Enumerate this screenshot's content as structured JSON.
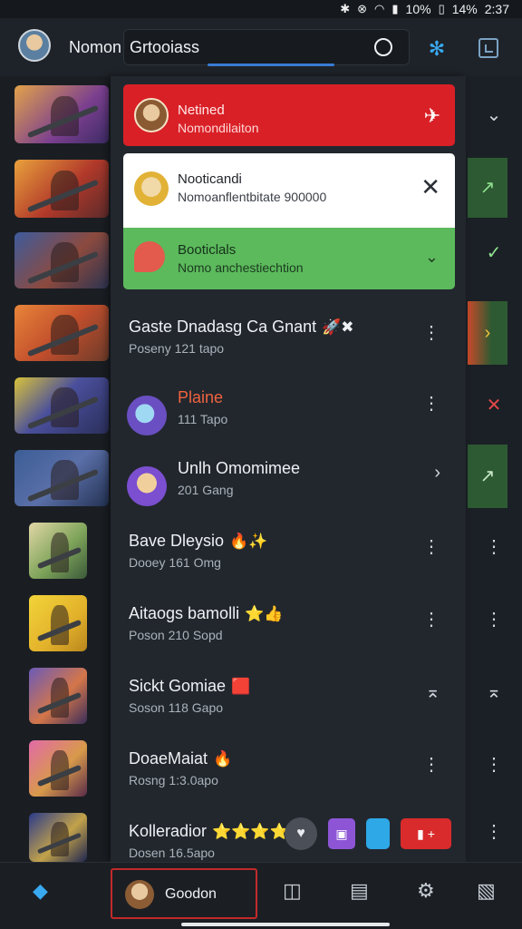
{
  "status_bar": {
    "icons": [
      "bluetooth-icon",
      "mute-icon",
      "wifi-icon",
      "signal-icon"
    ],
    "battery_1": "10%",
    "battery_2": "14%",
    "time": "2:37"
  },
  "top_bar": {
    "title": "Nomon",
    "search_text": "Grtooiass",
    "accent": "#3a7bd5"
  },
  "notifications": [
    {
      "title": "Netined",
      "subtitle": "Nomondilaiton",
      "color": "#d92027",
      "action_icon": "pin-icon"
    },
    {
      "title": "Nooticandi",
      "subtitle": "Nomoanflentbitate 900000",
      "color": "#ffffff",
      "action_icon": "close-icon"
    },
    {
      "title": "Booticlals",
      "subtitle": "Nomo anchestiechtion",
      "color": "#5cba5c",
      "action_icon": "chevron-down-icon"
    }
  ],
  "rows": [
    {
      "title": "Gaste Dnadasg Ca Gnant",
      "sub": "Poseny 121 tapo",
      "emoji": "🚀✖"
    },
    {
      "title": "Plaine",
      "sub": "111 Tapo",
      "emoji": ""
    },
    {
      "title": "Unlh Omomimee",
      "sub": "201 Gang",
      "emoji": ""
    },
    {
      "title": "Bave Dleysio",
      "sub": "Dooey 161 Omg",
      "emoji": "🔥✨"
    },
    {
      "title": "Aitaogs bamolli",
      "sub": "Poson 210 Sopd",
      "emoji": "⭐👍"
    },
    {
      "title": "Sickt Gomiae",
      "sub": "Soson 118 Gapo",
      "emoji": "🟥"
    },
    {
      "title": "DoaeMaiat",
      "sub": "Rosng 1:3.0apo",
      "emoji": "🔥"
    },
    {
      "title": "Kolleradior",
      "sub": "Dosen 16.5apo",
      "emoji": "⭐⭐⭐⭐"
    }
  ],
  "bottom_nav": {
    "active_label": "Goodon",
    "items": [
      "layers-icon",
      "columns-icon",
      "chat-icon",
      "settings-icon",
      "clipboard-icon"
    ]
  }
}
